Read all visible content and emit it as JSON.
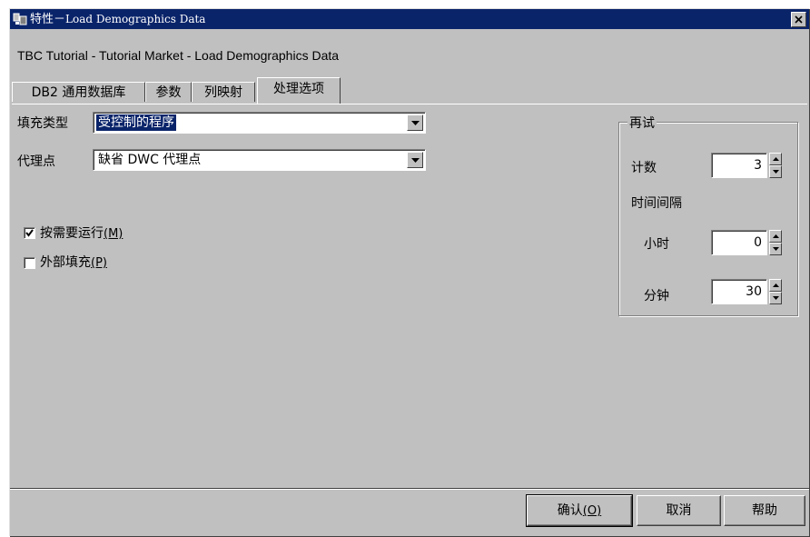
{
  "window": {
    "title_zh": "特性－",
    "title_en": "Load Demographics Data",
    "close_label": "✕"
  },
  "subtitle": "TBC Tutorial - Tutorial Market - Load Demographics Data",
  "tabs": [
    {
      "label": "DB2 通用数据库",
      "active": false
    },
    {
      "label": "参数",
      "active": false
    },
    {
      "label": "列映射",
      "active": false
    },
    {
      "label": "处理选项",
      "active": true
    }
  ],
  "form": {
    "populate_type_label": "填充类型",
    "populate_type_value": "受控制的程序",
    "agent_site_label": "代理点",
    "agent_site_value": "缺省 DWC 代理点",
    "run_on_demand": {
      "label": "按需要运行",
      "mnemonic": "(M)",
      "checked": true
    },
    "externally_populated": {
      "label": "外部填充",
      "mnemonic": "(P)",
      "checked": false
    }
  },
  "retry": {
    "group_title": "再试",
    "count_label": "计数",
    "count_value": "3",
    "interval_label": "时间间隔",
    "hours_label": "小时",
    "hours_value": "0",
    "minutes_label": "分钟",
    "minutes_value": "30"
  },
  "buttons": {
    "ok_label": "确认",
    "ok_mnemonic": "(O)",
    "cancel_label": "取消",
    "help_label": "帮助"
  },
  "colors": {
    "titlebar": "#0a246a",
    "face": "#c0c0c0",
    "selection": "#0a246a"
  }
}
